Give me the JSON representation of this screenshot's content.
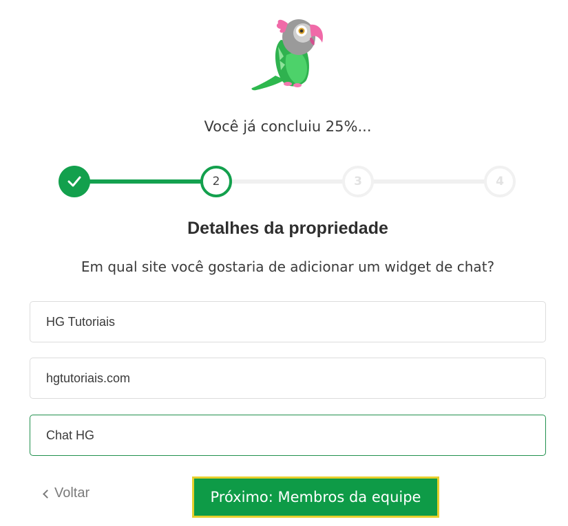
{
  "header": {
    "logo_icon": "parrot-logo-icon",
    "progress_text": "Você já concluiu 25%..."
  },
  "stepper": {
    "steps": [
      {
        "label": "",
        "state": "complete",
        "icon": "check-icon"
      },
      {
        "label": "2",
        "state": "current"
      },
      {
        "label": "3",
        "state": "pending"
      },
      {
        "label": "4",
        "state": "pending"
      }
    ],
    "completed_fraction": 0.333
  },
  "form": {
    "title": "Detalhes da propriedade",
    "question": "Em qual site você gostaria de adicionar um widget de chat?",
    "fields": [
      {
        "value": "HG Tutoriais"
      },
      {
        "value": "hgtutoriais.com"
      },
      {
        "value": "Chat HG",
        "focused": true
      }
    ]
  },
  "actions": {
    "back_label": "Voltar",
    "next_label": "Próximo: Membros da equipe"
  },
  "colors": {
    "primary_green": "#13a04d",
    "highlight_border": "#e7cf2c",
    "pending_gray": "#f1f1f1"
  }
}
